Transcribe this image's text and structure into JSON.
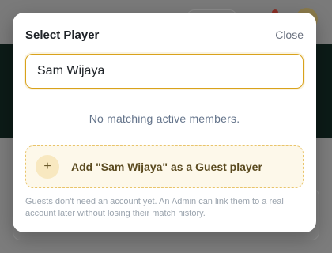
{
  "modal": {
    "title": "Select Player",
    "close_label": "Close",
    "search": {
      "value": "Sam Wijaya",
      "placeholder": ""
    },
    "empty_message": "No matching active members.",
    "add_guest": {
      "icon_glyph": "+",
      "icon": "plus-icon",
      "label": "Add \"Sam Wijaya\" as a Guest player"
    },
    "help_text": "Guests don't need an account yet. An Admin can link them to a real account later without losing their match history."
  },
  "colors": {
    "accent": "#d9a21b",
    "guest_bg": "#fdf8ea",
    "muted_text": "#64748b"
  }
}
